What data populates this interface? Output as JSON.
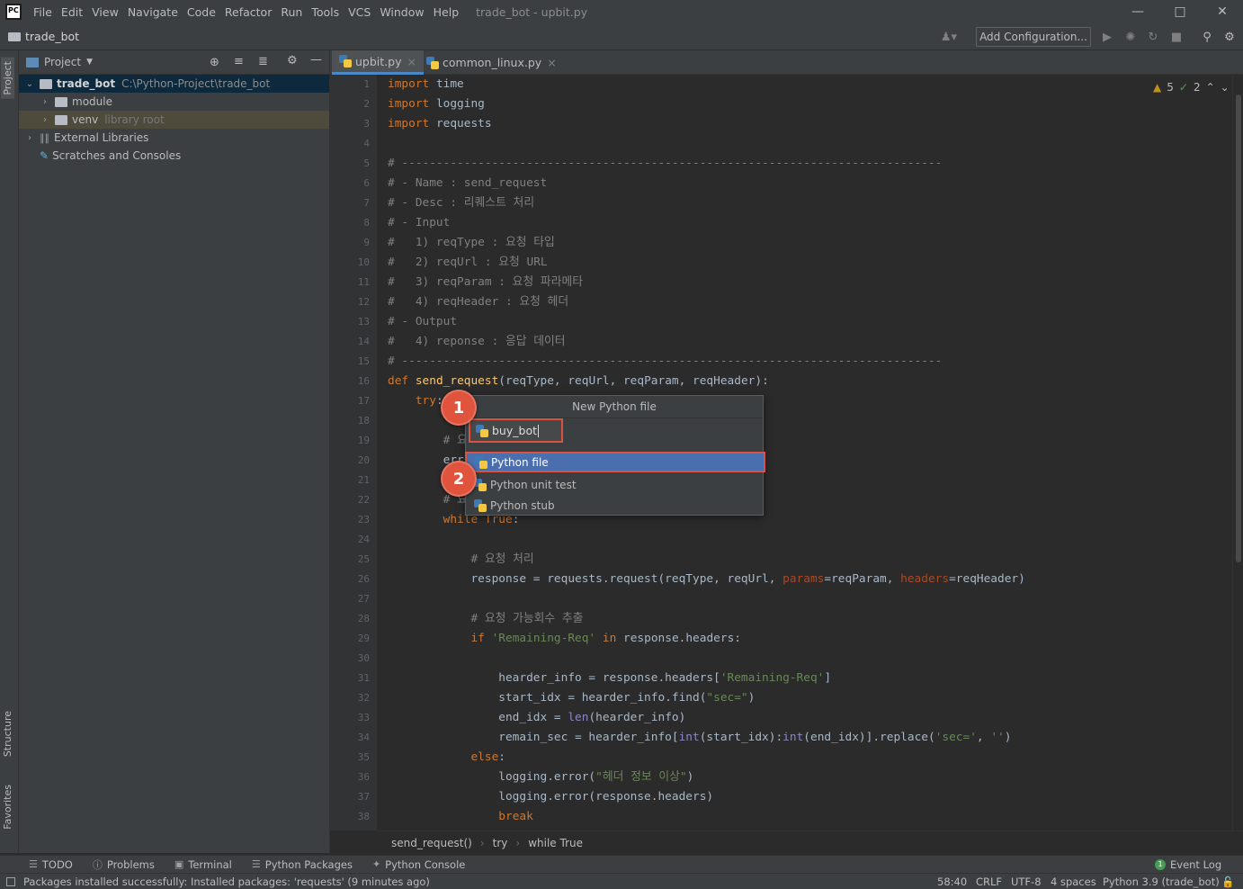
{
  "window": {
    "title": "trade_bot - upbit.py",
    "logo": "PC"
  },
  "menu": [
    "File",
    "Edit",
    "View",
    "Navigate",
    "Code",
    "Refactor",
    "Run",
    "Tools",
    "VCS",
    "Window",
    "Help"
  ],
  "navbar": {
    "project": "trade_bot",
    "add_configuration": "Add Configuration..."
  },
  "left_strip": {
    "project": "Project",
    "structure": "Structure",
    "favorites": "Favorites"
  },
  "project_panel": {
    "title": "Project",
    "tree": [
      {
        "label": "trade_bot",
        "note": "C:\\Python-Project\\trade_bot"
      },
      {
        "label": "module",
        "note": ""
      },
      {
        "label": "venv",
        "note": "library root"
      },
      {
        "label": "External Libraries",
        "note": ""
      },
      {
        "label": "Scratches and Consoles",
        "note": ""
      }
    ]
  },
  "tabs": [
    {
      "label": "upbit.py"
    },
    {
      "label": "common_linux.py"
    }
  ],
  "inspections": {
    "warnings": "5",
    "weak_warnings": "2"
  },
  "code_lines": [
    "import time",
    "import logging",
    "import requests",
    "",
    "# ------------------------------------------------------------------------------",
    "# - Name : send_request",
    "# - Desc : 리퀘스트 처리",
    "# - Input",
    "#   1) reqType : 요청 타입",
    "#   2) reqUrl : 요청 URL",
    "#   3) reqParam : 요청 파라메타",
    "#   4) reqHeader : 요청 헤더",
    "# - Output",
    "#   4) reponse : 응답 데이터",
    "# ------------------------------------------------------------------------------",
    "def send_request(reqType, reqUrl, reqParam, reqHeader):",
    "    try:",
    "",
    "        # 요",
    "        err",
    "",
    "        # 요",
    "        while True:",
    "",
    "            # 요청 처리",
    "            response = requests.request(reqType, reqUrl, params=reqParam, headers=reqHeader)",
    "",
    "            # 요청 가능회수 추출",
    "            if 'Remaining-Req' in response.headers:",
    "",
    "                hearder_info = response.headers['Remaining-Req']",
    "                start_idx = hearder_info.find(\"sec=\")",
    "                end_idx = len(hearder_info)",
    "                remain_sec = hearder_info[int(start_idx):int(end_idx)].replace('sec=', '')",
    "            else:",
    "                logging.error(\"헤더 정보 이상\")",
    "                logging.error(response.headers)",
    "                break"
  ],
  "popup": {
    "title": "New Python file",
    "input_value": "buy_bot",
    "items": [
      "Python file",
      "Python unit test",
      "Python stub"
    ],
    "badge1": "1",
    "badge2": "2"
  },
  "breadcrumbs": [
    "send_request()",
    "try",
    "while True"
  ],
  "tool_windows": [
    "TODO",
    "Problems",
    "Terminal",
    "Python Packages",
    "Python Console"
  ],
  "event_log": {
    "count": "1",
    "label": "Event Log"
  },
  "status": {
    "message": "Packages installed successfully: Installed packages: 'requests' (9 minutes ago)",
    "position": "58:40",
    "line_sep": "CRLF",
    "encoding": "UTF-8",
    "indent": "4 spaces",
    "interpreter": "Python 3.9 (trade_bot)"
  },
  "colors": {
    "accent": "#4b6eaf",
    "highlight": "#d9533e",
    "keyword": "#cc7832",
    "comment": "#808080",
    "string": "#6a8759",
    "function": "#ffc66d"
  }
}
